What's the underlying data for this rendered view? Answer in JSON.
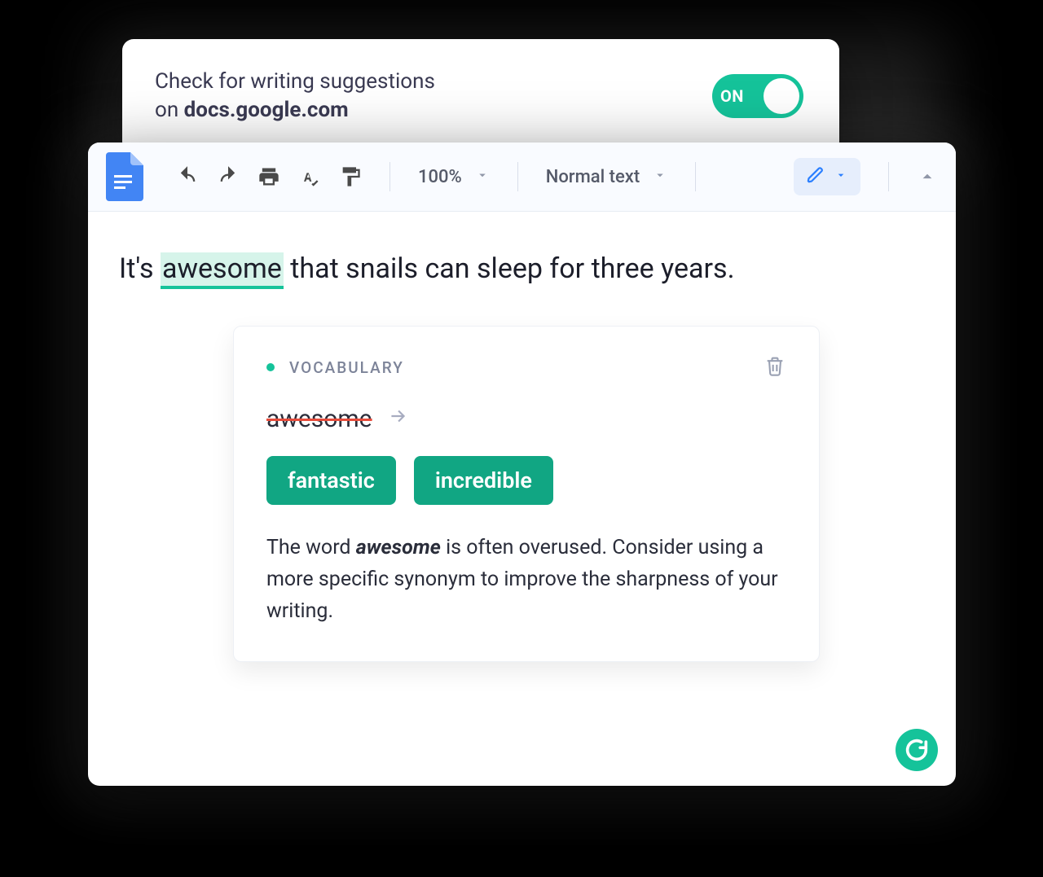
{
  "colors": {
    "accent": "#15c39a",
    "link_blue": "#2a7fff",
    "strike_red": "#e74c3c"
  },
  "top_card": {
    "line1": "Check for writing suggestions",
    "line2_prefix": "on ",
    "domain": "docs.google.com",
    "toggle_label": "ON"
  },
  "toolbar": {
    "zoom": "100%",
    "style": "Normal text"
  },
  "document": {
    "sentence_pre": "It's ",
    "highlighted": "awesome",
    "sentence_post": " that snails can sleep for three years."
  },
  "suggestion": {
    "category": "VOCABULARY",
    "original": "awesome",
    "replacements": [
      "fantastic",
      "incredible"
    ],
    "explanation_pre": "The word ",
    "explanation_bold": "awesome",
    "explanation_post": " is often overused. Consider using a more specific synonym to improve the sharpness of your writing."
  }
}
